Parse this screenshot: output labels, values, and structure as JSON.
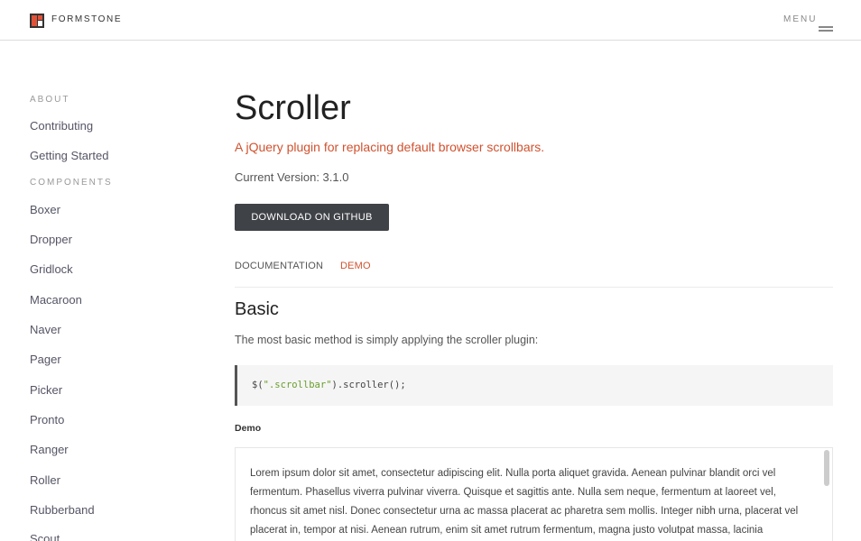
{
  "header": {
    "brand": "FORMSTONE",
    "menu_label": "MENU"
  },
  "sidebar": {
    "about_heading": "ABOUT",
    "about_items": [
      "Contributing",
      "Getting Started"
    ],
    "components_heading": "COMPONENTS",
    "component_items": [
      "Boxer",
      "Dropper",
      "Gridlock",
      "Macaroon",
      "Naver",
      "Pager",
      "Picker",
      "Pronto",
      "Ranger",
      "Roller",
      "Rubberband",
      "Scout"
    ]
  },
  "main": {
    "title": "Scroller",
    "tagline": "A jQuery plugin for replacing default browser scrollbars.",
    "version": "Current Version: 3.1.0",
    "download_label": "DOWNLOAD ON GITHUB",
    "tabs": [
      {
        "label": "DOCUMENTATION",
        "active": false
      },
      {
        "label": "DEMO",
        "active": true
      }
    ],
    "section_title": "Basic",
    "section_desc": "The most basic method is simply applying the scroller plugin:",
    "code": {
      "prefix": "$(",
      "string": "\".scrollbar\"",
      "suffix": ").scroller();"
    },
    "demo_label": "Demo",
    "demo_text": "Lorem ipsum dolor sit amet, consectetur adipiscing elit. Nulla porta aliquet gravida. Aenean pulvinar blandit orci vel fermentum. Phasellus viverra pulvinar viverra. Quisque et sagittis ante. Nulla sem neque, fermentum at laoreet vel, rhoncus sit amet nisl. Donec consectetur urna ac massa placerat ac pharetra sem mollis. Integer nibh urna, placerat vel placerat in, tempor at nisi. Aenean rutrum, enim sit amet rutrum fermentum, magna justo volutpat massa, lacinia"
  },
  "colors": {
    "accent": "#d0522f",
    "button_bg": "#3f4247"
  }
}
